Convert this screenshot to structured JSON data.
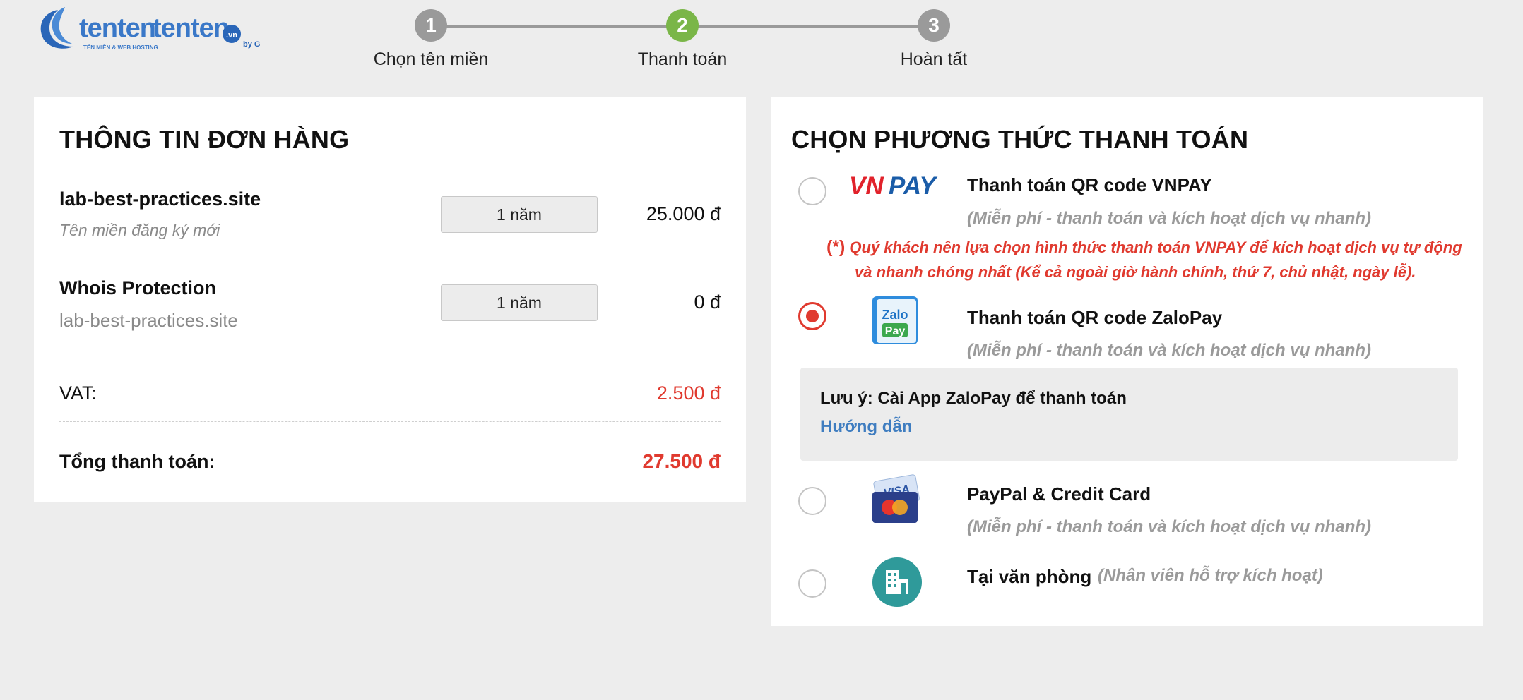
{
  "logo": {
    "brand": "tenten",
    "tld": ".vn",
    "tagline": "TÊN MIỀN & WEB HOSTING",
    "by": "by GMO"
  },
  "steps": [
    {
      "number": "1",
      "label": "Chọn tên miền",
      "active": false
    },
    {
      "number": "2",
      "label": "Thanh toán",
      "active": true
    },
    {
      "number": "3",
      "label": "Hoàn tất",
      "active": false
    }
  ],
  "order": {
    "title": "THÔNG TIN ĐƠN HÀNG",
    "items": [
      {
        "name": "lab-best-practices.site",
        "subtitle": "Tên miền đăng ký mới",
        "period": "1 năm",
        "price": "25.000 đ"
      },
      {
        "name": "Whois Protection",
        "subtitle": "lab-best-practices.site",
        "period": "1 năm",
        "price": "0 đ"
      }
    ],
    "vat_label": "VAT:",
    "vat_value": "2.500 đ",
    "total_label": "Tổng thanh toán:",
    "total_value": "27.500 đ"
  },
  "payment": {
    "title": "CHỌN PHƯƠNG THỨC THANH TOÁN",
    "methods": [
      {
        "title": "Thanh toán QR code VNPAY",
        "subtitle": "(Miễn phí - thanh toán và kích hoạt dịch vụ nhanh)",
        "icon": "vnpay-logo",
        "selected": false
      },
      {
        "title": "Thanh toán QR code ZaloPay",
        "subtitle": "(Miễn phí - thanh toán và kích hoạt dịch vụ nhanh)",
        "icon": "zalopay-logo",
        "selected": true
      },
      {
        "title": "PayPal & Credit Card",
        "subtitle": "(Miễn phí - thanh toán và kích hoạt dịch vụ nhanh)",
        "icon": "credit-card-icon",
        "selected": false
      },
      {
        "title": "Tại văn phòng",
        "note": "(Nhân viên hỗ trợ kích hoạt)",
        "icon": "office-building-icon",
        "selected": false
      }
    ],
    "vnpay_warning_mark": "(*)",
    "vnpay_warning_line1": "Quý khách nên lựa chọn hình thức thanh toán VNPAY để kích hoạt dịch vụ tự động",
    "vnpay_warning_line2": "và nhanh chóng nhất (Kể cả ngoài giờ hành chính, thứ 7, chủ nhật, ngày lễ).",
    "vnpay_logo_vn": "VN",
    "vnpay_logo_pay": "PAY",
    "zalopay_logo_zalo": "Zalo",
    "zalopay_logo_pay": "Pay",
    "card_logo_visa": "VISA",
    "zalopay_note": "Lưu ý: Cài App ZaloPay để thanh toán",
    "zalopay_guide": "Hướng dẫn"
  },
  "colors": {
    "accent_green": "#7ab648",
    "accent_red": "#e03a2f",
    "link_blue": "#3f7dc0",
    "step_gray": "#9a9a9a"
  }
}
